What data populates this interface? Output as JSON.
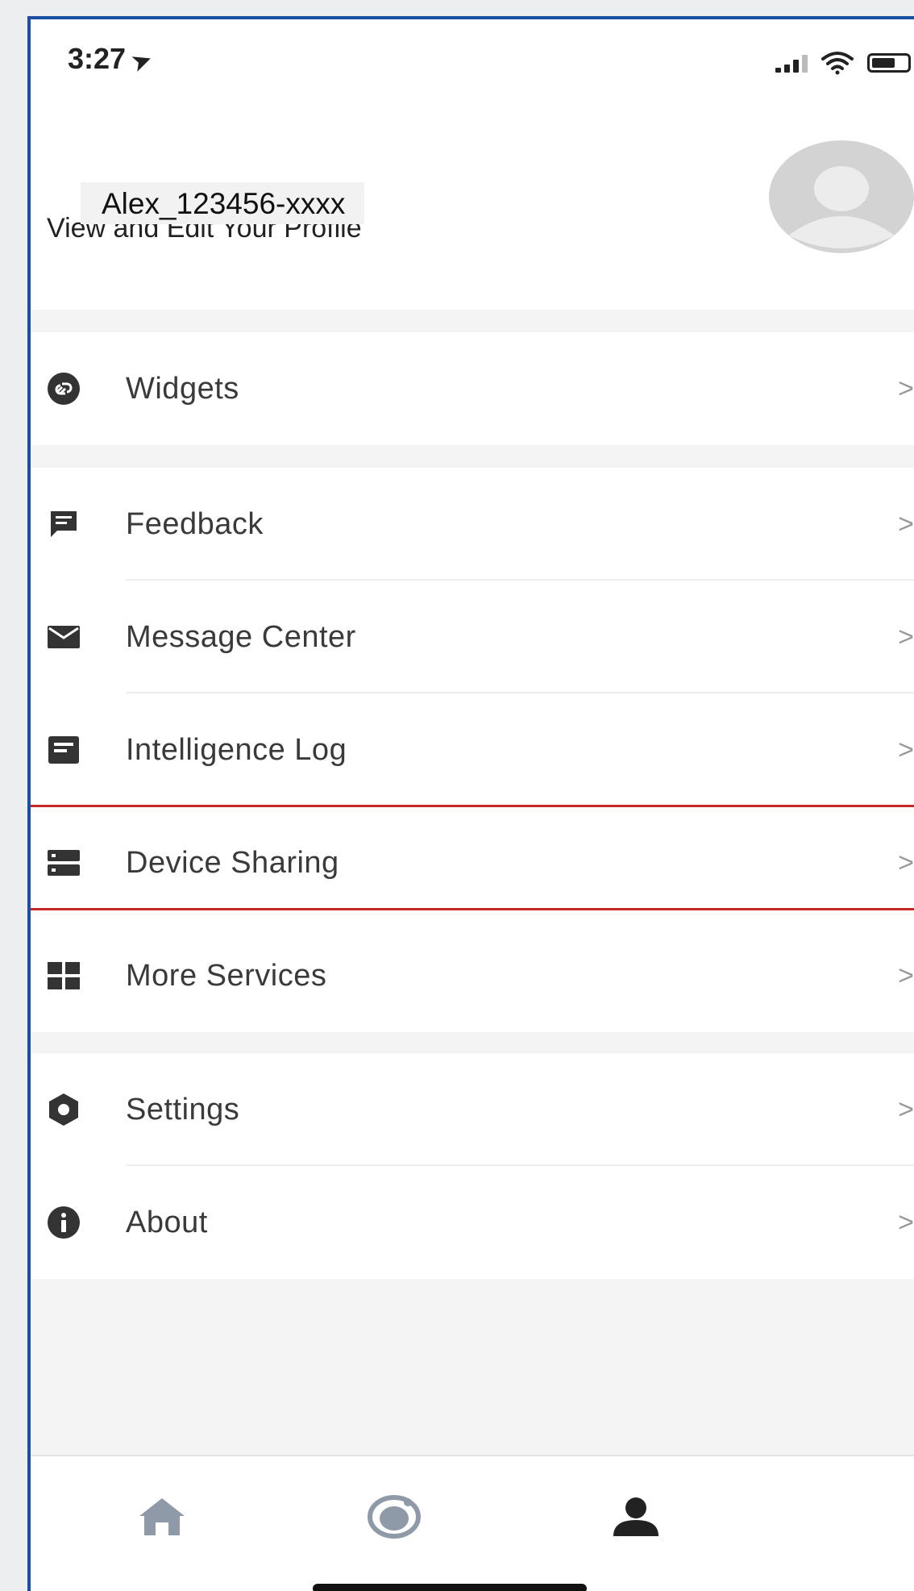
{
  "status": {
    "time": "3:27"
  },
  "profile": {
    "name": "Alex_123456-xxxx",
    "subtitle": "View and Edit Your Profile"
  },
  "menu": {
    "widgets": "Widgets",
    "feedback": "Feedback",
    "message_center": "Message Center",
    "intelligence_log": "Intelligence Log",
    "device_sharing": "Device Sharing",
    "more_services": "More Services",
    "settings": "Settings",
    "about": "About"
  },
  "chevron": ">",
  "colors": {
    "highlight": "#c62828",
    "frame": "#1a4fa3",
    "icon": "#333333",
    "tab_inactive": "#8e9aa8"
  },
  "icons": {
    "widgets": "link-circle-icon",
    "feedback": "chat-icon",
    "message_center": "envelope-icon",
    "intelligence_log": "log-icon",
    "device_sharing": "server-icon",
    "more_services": "grid-icon",
    "settings": "hexagon-gear-icon",
    "about": "info-icon"
  },
  "tabs": [
    "home-icon",
    "scene-icon",
    "person-icon"
  ]
}
